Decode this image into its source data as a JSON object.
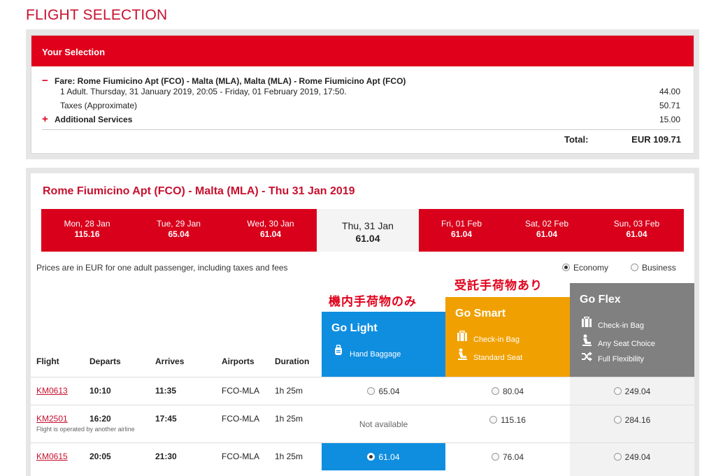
{
  "page_title": "FLIGHT SELECTION",
  "selection": {
    "header": "Your Selection",
    "fare_line": "Fare: Rome Fiumicino Apt (FCO) - Malta (MLA), Malta (MLA) - Rome Fiumicino Apt (FCO)",
    "fare_detail": "1 Adult. Thursday, 31 January 2019, 20:05 - Friday, 01 February 2019, 17:50.",
    "fare_amount": "44.00",
    "taxes_label": "Taxes (Approximate)",
    "taxes_amount": "50.71",
    "additional_label": "Additional Services",
    "additional_amount": "15.00",
    "total_label": "Total:",
    "total_value": "EUR 109.71",
    "minus_sign": "−",
    "plus_sign": "+"
  },
  "route_title": "Rome Fiumicino Apt (FCO) - Malta (MLA) - Thu 31 Jan 2019",
  "dates": [
    {
      "date": "Mon, 28 Jan",
      "price": "115.16"
    },
    {
      "date": "Tue, 29 Jan",
      "price": "65.04"
    },
    {
      "date": "Wed, 30 Jan",
      "price": "61.04"
    },
    {
      "date": "Thu, 31 Jan",
      "price": "61.04"
    },
    {
      "date": "Fri, 01 Feb",
      "price": "61.04"
    },
    {
      "date": "Sat, 02 Feb",
      "price": "61.04"
    },
    {
      "date": "Sun, 03 Feb",
      "price": "61.04"
    }
  ],
  "price_note": "Prices are in EUR for one adult passenger, including taxes and fees",
  "cabins": {
    "economy": "Economy",
    "business": "Business"
  },
  "jp_annotations": {
    "light": "機内手荷物のみ",
    "smart": "受託手荷物あり"
  },
  "fares": {
    "light": {
      "title": "Go Light",
      "features": [
        {
          "icon": "bag-icon",
          "label": "Hand Baggage"
        }
      ],
      "color": "#0f8ee0"
    },
    "smart": {
      "title": "Go Smart",
      "features": [
        {
          "icon": "checkin-bag-icon",
          "label": "Check-in Bag"
        },
        {
          "icon": "seat-icon",
          "label": "Standard Seat"
        }
      ],
      "color": "#f0a000"
    },
    "flex": {
      "title": "Go Flex",
      "features": [
        {
          "icon": "checkin-bag-icon",
          "label": "Check-in Bag"
        },
        {
          "icon": "seat-icon",
          "label": "Any Seat Choice"
        },
        {
          "icon": "shuffle-icon",
          "label": "Full Flexibility"
        }
      ],
      "color": "#808080"
    }
  },
  "columns": {
    "flight": "Flight",
    "departs": "Departs",
    "arrives": "Arrives",
    "airports": "Airports",
    "duration": "Duration"
  },
  "flights": [
    {
      "flight": "KM0613",
      "departs": "10:10",
      "arrives": "11:35",
      "airports": "FCO-MLA",
      "duration": "1h 25m",
      "note": "",
      "light": "65.04",
      "smart": "80.04",
      "flex": "249.04"
    },
    {
      "flight": "KM2501",
      "departs": "16:20",
      "arrives": "17:45",
      "airports": "FCO-MLA",
      "duration": "1h 25m",
      "note": "Flight is operated by another airline",
      "light": "Not available",
      "smart": "115.16",
      "flex": "284.16"
    },
    {
      "flight": "KM0615",
      "departs": "20:05",
      "arrives": "21:30",
      "airports": "FCO-MLA",
      "duration": "1h 25m",
      "note": "",
      "light": "61.04",
      "smart": "76.04",
      "flex": "249.04"
    }
  ]
}
